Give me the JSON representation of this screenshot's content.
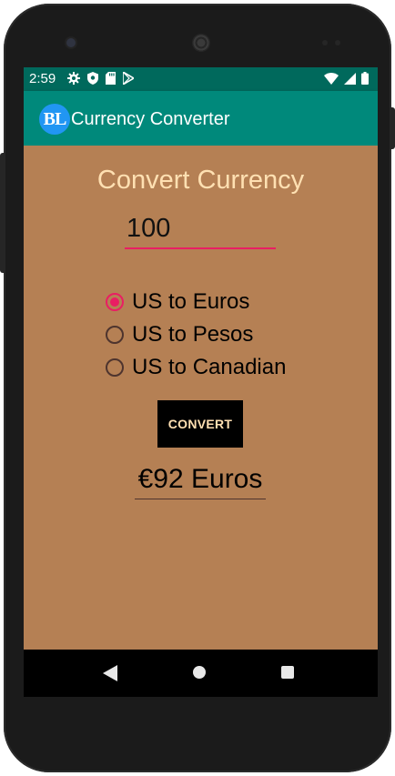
{
  "status_bar": {
    "time": "2:59",
    "left_icons": [
      "gear-icon",
      "shield-icon",
      "sd-card-icon",
      "play-store-icon"
    ],
    "right_icons": [
      "wifi-icon",
      "signal-icon",
      "battery-icon"
    ]
  },
  "app_bar": {
    "logo_text": "BL",
    "title": "Currency Converter",
    "color": "#00897b"
  },
  "main": {
    "heading": "Convert Currency",
    "amount_value": "100",
    "radio_options": [
      {
        "label": "US to Euros",
        "checked": true
      },
      {
        "label": "US to Pesos",
        "checked": false
      },
      {
        "label": "US to Canadian",
        "checked": false
      }
    ],
    "convert_button_label": "CONVERT",
    "result_text": "€92 Euros",
    "background_color": "#b58054",
    "accent_color": "#e91e63"
  },
  "nav_bar": {
    "icons": [
      "back-icon",
      "home-icon",
      "recents-icon"
    ]
  }
}
